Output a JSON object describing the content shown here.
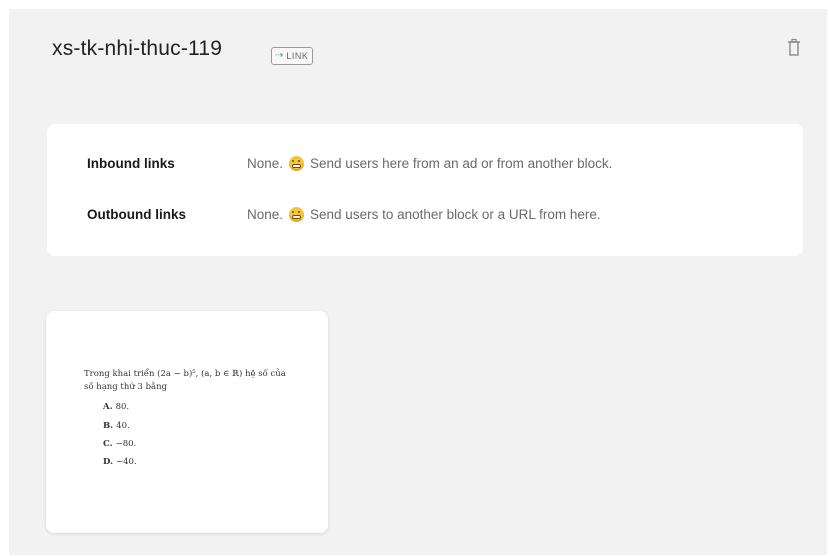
{
  "block": {
    "title": "xs-tk-nhi-thuc-119",
    "link_badge_label": "LINK",
    "link_badge_icon": "link-arrow-icon",
    "delete_icon": "trash-icon"
  },
  "links": {
    "inbound": {
      "label": "Inbound links",
      "none_text": "None.",
      "hint": "Send users here from an ad or from another block."
    },
    "outbound": {
      "label": "Outbound links",
      "none_text": "None.",
      "hint": "Send users to another block or a URL from here."
    },
    "emoji_icon": "grimacing-face-icon"
  },
  "image_card": {
    "question_line1": "Trong khai triển (2a − b)⁵, (a, b ∈ ℝ) hệ số của",
    "question_line2": "số hạng thứ 3 bằng",
    "options": [
      {
        "key": "A.",
        "value": "80."
      },
      {
        "key": "B.",
        "value": "40."
      },
      {
        "key": "C.",
        "value": "−80."
      },
      {
        "key": "D.",
        "value": "−40."
      }
    ]
  },
  "colors": {
    "panel_bg": "#f2f2f2",
    "card_bg": "#ffffff",
    "link_badge_accent": "#5a9a8a"
  }
}
